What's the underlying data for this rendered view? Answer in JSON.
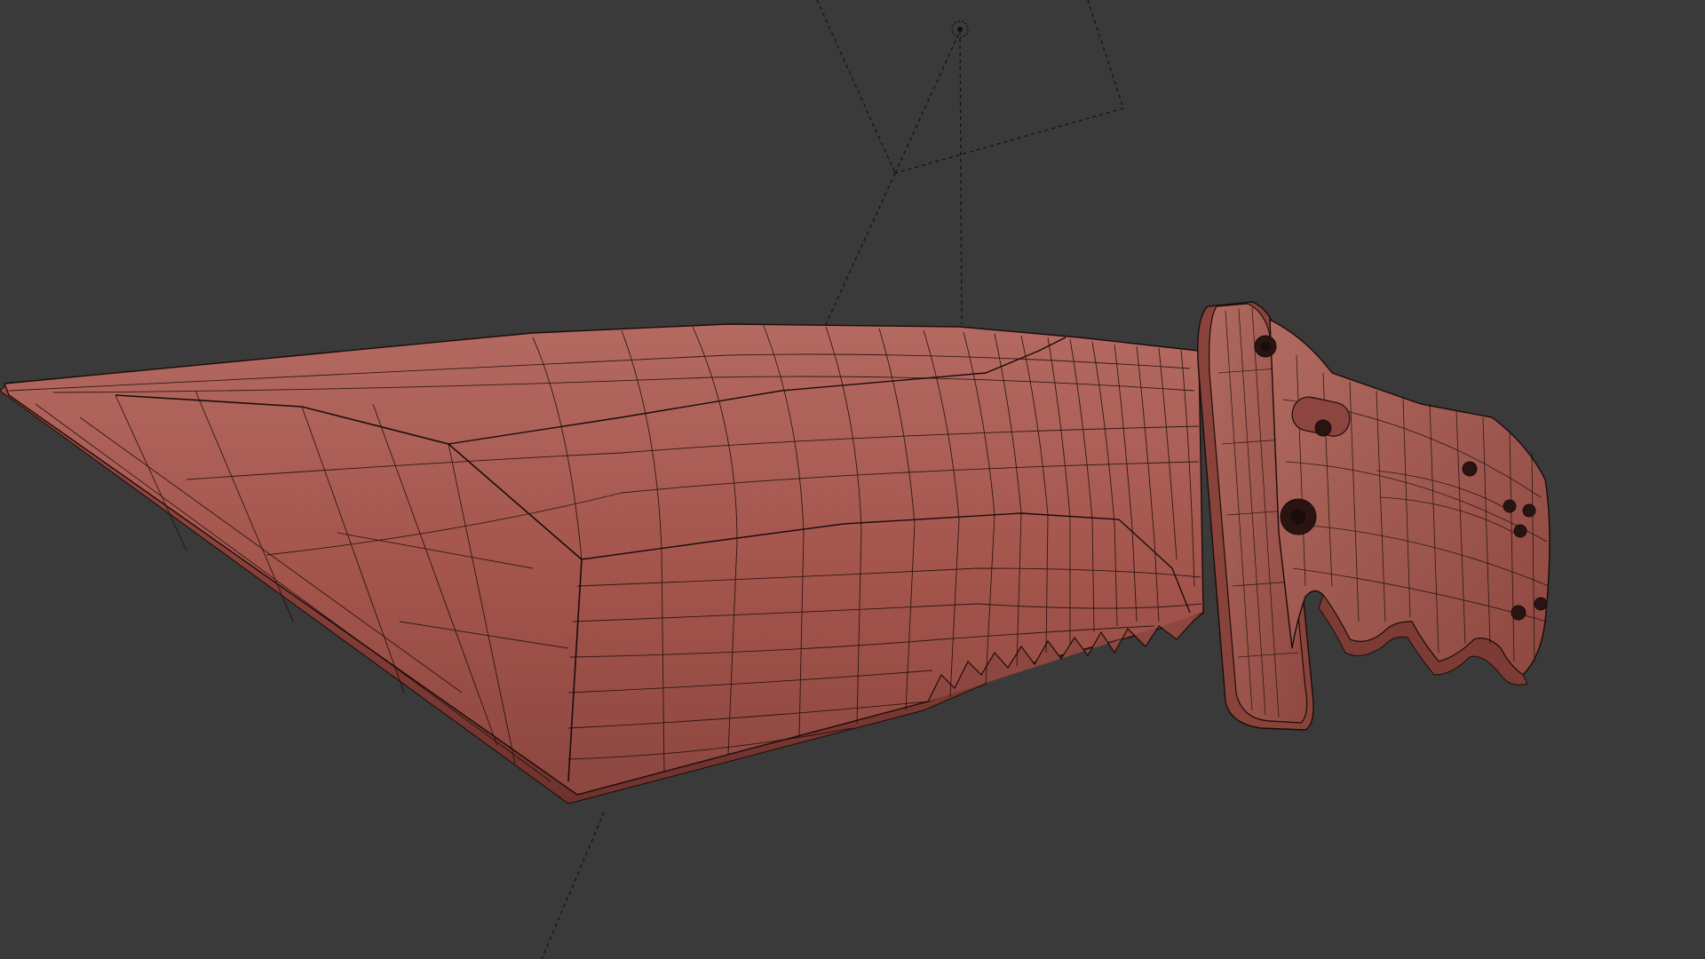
{
  "viewport": {
    "background_color": "#3a3a3a",
    "shading_mode": "solid-with-wireframe"
  },
  "model": {
    "object_kind": "combat-knife",
    "material_color": "#a8564f",
    "material_shadow_color": "#7a3a34",
    "wire_color": "#1a0c0a"
  },
  "scene_helpers": {
    "light_icon": "light-icon",
    "camera_helper": "camera-frustum-icon",
    "helper_line_color": "#111111"
  }
}
